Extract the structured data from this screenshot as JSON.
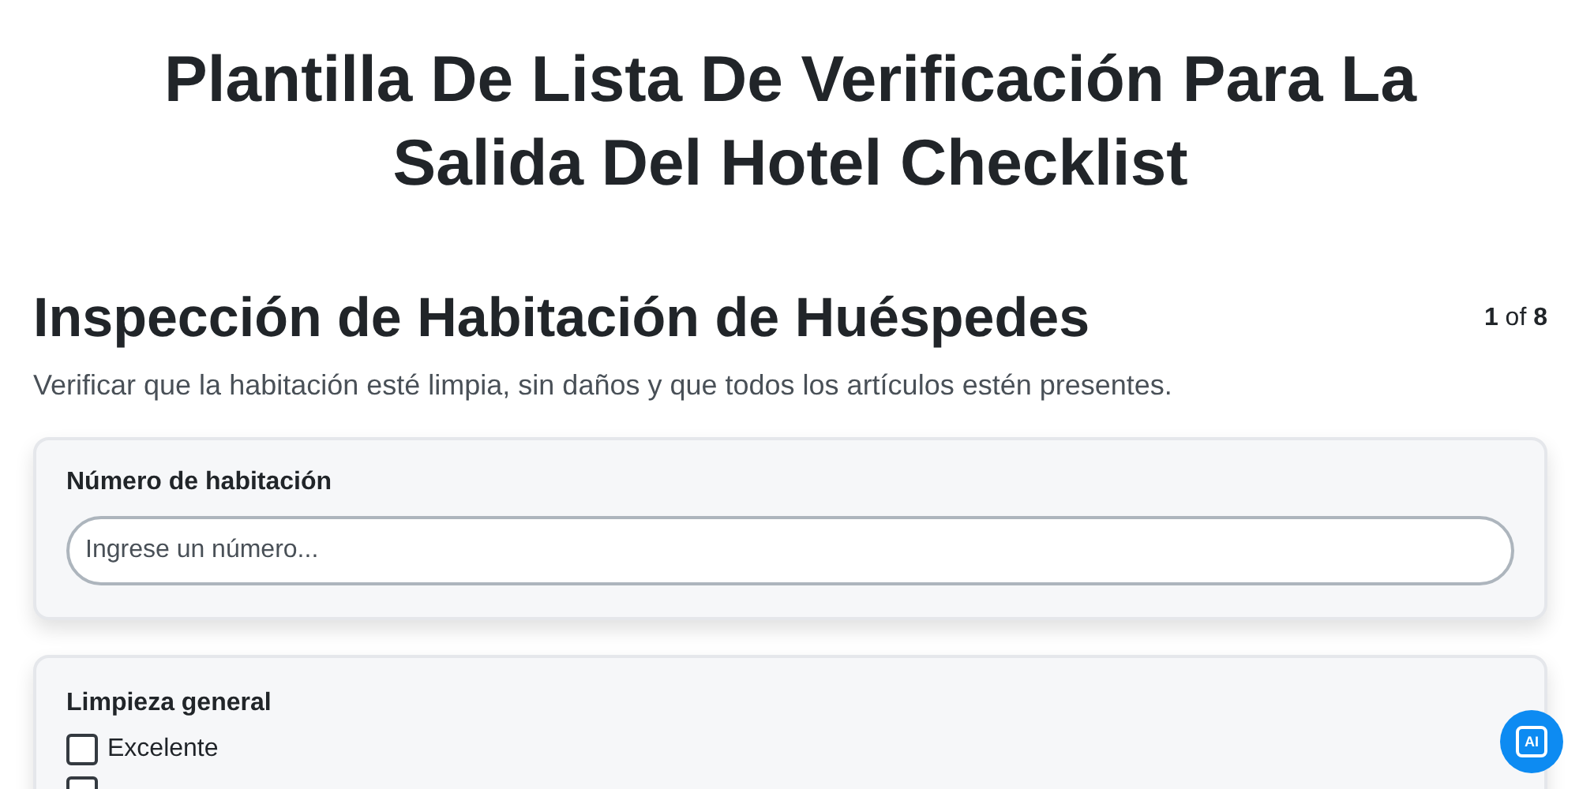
{
  "title": "Plantilla De Lista De Verificación Para La Salida Del Hotel Checklist",
  "section": {
    "heading": "Inspección de Habitación de Huéspedes",
    "counter": "**1** of **8**",
    "description": "Verificar que la habitación esté limpia, sin daños y que todos los artículos estén presentes."
  },
  "questions": [
    {
      "kind": "text",
      "label": "Número de habitación",
      "placeholder": "Ingrese un número..."
    },
    {
      "kind": "checkboxes",
      "label": "Limpieza general",
      "options": [
        {
          "label": "Excelente",
          "checked": false
        },
        {
          "checked": false
        }
      ]
    }
  ],
  "ai_button": {
    "label": "AI"
  }
}
